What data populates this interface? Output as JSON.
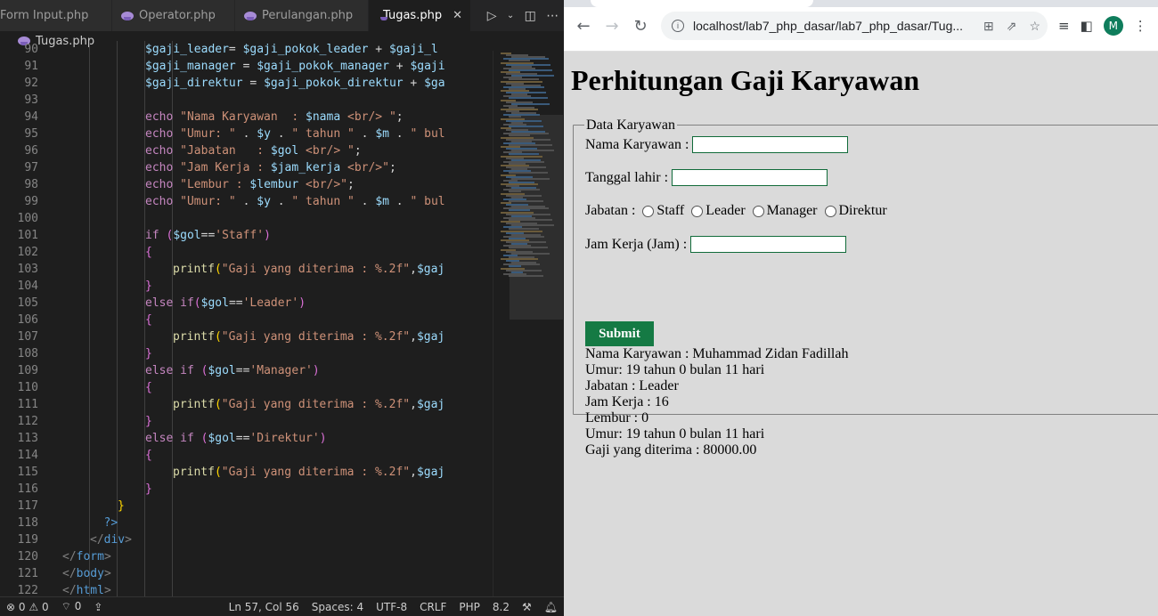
{
  "vscode": {
    "tabs": [
      {
        "label": "Form Input.php",
        "active": false
      },
      {
        "label": "Operator.php",
        "active": false
      },
      {
        "label": "Perulangan.php",
        "active": false
      },
      {
        "label": "Tugas.php",
        "active": true
      }
    ],
    "breadcrumb": "Tugas.php",
    "lines": [
      {
        "n": "90",
        "indent": 3,
        "tokens": [
          [
            "var",
            "$gaji_leader"
          ],
          [
            "",
            "= "
          ],
          [
            "var",
            "$gaji_pokok_leader"
          ],
          [
            "",
            " + "
          ],
          [
            "var",
            "$gaji_l"
          ]
        ]
      },
      {
        "n": "91",
        "indent": 3,
        "tokens": [
          [
            "var",
            "$gaji_manager"
          ],
          [
            "",
            " = "
          ],
          [
            "var",
            "$gaji_pokok_manager"
          ],
          [
            "",
            " + "
          ],
          [
            "var",
            "$gaji"
          ]
        ]
      },
      {
        "n": "92",
        "indent": 3,
        "tokens": [
          [
            "var",
            "$gaji_direktur"
          ],
          [
            "",
            " = "
          ],
          [
            "var",
            "$gaji_pokok_direktur"
          ],
          [
            "",
            " + "
          ],
          [
            "var",
            "$ga"
          ]
        ]
      },
      {
        "n": "93",
        "indent": 3,
        "tokens": []
      },
      {
        "n": "94",
        "indent": 3,
        "tokens": [
          [
            "kw",
            "echo "
          ],
          [
            "str",
            "\"Nama Karyawan  : "
          ],
          [
            "var",
            "$nama"
          ],
          [
            "str",
            " <br/> \""
          ],
          [
            "",
            ";"
          ]
        ]
      },
      {
        "n": "95",
        "indent": 3,
        "tokens": [
          [
            "kw",
            "echo "
          ],
          [
            "str",
            "\"Umur: \""
          ],
          [
            "",
            " . "
          ],
          [
            "var",
            "$y"
          ],
          [
            "",
            " . "
          ],
          [
            "str",
            "\" tahun \""
          ],
          [
            "",
            " . "
          ],
          [
            "var",
            "$m"
          ],
          [
            "",
            " . "
          ],
          [
            "str",
            "\" bul"
          ]
        ]
      },
      {
        "n": "96",
        "indent": 3,
        "tokens": [
          [
            "kw",
            "echo "
          ],
          [
            "str",
            "\"Jabatan   : "
          ],
          [
            "var",
            "$gol"
          ],
          [
            "str",
            " <br/> \""
          ],
          [
            "",
            ";"
          ]
        ]
      },
      {
        "n": "97",
        "indent": 3,
        "tokens": [
          [
            "kw",
            "echo "
          ],
          [
            "str",
            "\"Jam Kerja : "
          ],
          [
            "var",
            "$jam_kerja"
          ],
          [
            "str",
            " <br/>\""
          ],
          [
            "",
            ";"
          ]
        ]
      },
      {
        "n": "98",
        "indent": 3,
        "tokens": [
          [
            "kw",
            "echo "
          ],
          [
            "str",
            "\"Lembur : "
          ],
          [
            "var",
            "$lembur"
          ],
          [
            "str",
            " <br/>\""
          ],
          [
            "",
            ";"
          ]
        ]
      },
      {
        "n": "99",
        "indent": 3,
        "tokens": [
          [
            "kw",
            "echo "
          ],
          [
            "str",
            "\"Umur: \""
          ],
          [
            "",
            " . "
          ],
          [
            "var",
            "$y"
          ],
          [
            "",
            " . "
          ],
          [
            "str",
            "\" tahun \""
          ],
          [
            "",
            " . "
          ],
          [
            "var",
            "$m"
          ],
          [
            "",
            " . "
          ],
          [
            "str",
            "\" bul"
          ]
        ]
      },
      {
        "n": "100",
        "indent": 3,
        "tokens": []
      },
      {
        "n": "101",
        "indent": 3,
        "tokens": [
          [
            "kw",
            "if "
          ],
          [
            "brace2",
            "("
          ],
          [
            "var",
            "$gol"
          ],
          [
            "",
            "=="
          ],
          [
            "str",
            "'Staff'"
          ],
          [
            "brace2",
            ")"
          ]
        ]
      },
      {
        "n": "102",
        "indent": 3,
        "tokens": [
          [
            "brace2",
            "{"
          ]
        ]
      },
      {
        "n": "103",
        "indent": 4,
        "tokens": [
          [
            "fn",
            "printf"
          ],
          [
            "brace",
            "("
          ],
          [
            "str",
            "\"Gaji yang diterima : %.2f\""
          ],
          [
            "",
            ","
          ],
          [
            "var",
            "$gaj"
          ]
        ]
      },
      {
        "n": "104",
        "indent": 3,
        "tokens": [
          [
            "brace2",
            "}"
          ]
        ]
      },
      {
        "n": "105",
        "indent": 3,
        "tokens": [
          [
            "kw",
            "else if"
          ],
          [
            "brace2",
            "("
          ],
          [
            "var",
            "$gol"
          ],
          [
            "",
            "=="
          ],
          [
            "str",
            "'Leader'"
          ],
          [
            "brace2",
            ")"
          ]
        ]
      },
      {
        "n": "106",
        "indent": 3,
        "tokens": [
          [
            "brace2",
            "{"
          ]
        ]
      },
      {
        "n": "107",
        "indent": 4,
        "tokens": [
          [
            "fn",
            "printf"
          ],
          [
            "brace",
            "("
          ],
          [
            "str",
            "\"Gaji yang diterima : %.2f\""
          ],
          [
            "",
            ","
          ],
          [
            "var",
            "$gaj"
          ]
        ]
      },
      {
        "n": "108",
        "indent": 3,
        "tokens": [
          [
            "brace2",
            "}"
          ]
        ]
      },
      {
        "n": "109",
        "indent": 3,
        "tokens": [
          [
            "kw",
            "else if "
          ],
          [
            "brace2",
            "("
          ],
          [
            "var",
            "$gol"
          ],
          [
            "",
            "=="
          ],
          [
            "str",
            "'Manager'"
          ],
          [
            "brace2",
            ")"
          ]
        ]
      },
      {
        "n": "110",
        "indent": 3,
        "tokens": [
          [
            "brace2",
            "{"
          ]
        ]
      },
      {
        "n": "111",
        "indent": 4,
        "tokens": [
          [
            "fn",
            "printf"
          ],
          [
            "brace",
            "("
          ],
          [
            "str",
            "\"Gaji yang diterima : %.2f\""
          ],
          [
            "",
            ","
          ],
          [
            "var",
            "$gaj"
          ]
        ]
      },
      {
        "n": "112",
        "indent": 3,
        "tokens": [
          [
            "brace2",
            "}"
          ]
        ]
      },
      {
        "n": "113",
        "indent": 3,
        "tokens": [
          [
            "kw",
            "else if "
          ],
          [
            "brace2",
            "("
          ],
          [
            "var",
            "$gol"
          ],
          [
            "",
            "=="
          ],
          [
            "str",
            "'Direktur'"
          ],
          [
            "brace2",
            ")"
          ]
        ]
      },
      {
        "n": "114",
        "indent": 3,
        "tokens": [
          [
            "brace2",
            "{"
          ]
        ]
      },
      {
        "n": "115",
        "indent": 4,
        "tokens": [
          [
            "fn",
            "printf"
          ],
          [
            "brace",
            "("
          ],
          [
            "str",
            "\"Gaji yang diterima : %.2f\""
          ],
          [
            "",
            ","
          ],
          [
            "var",
            "$gaj"
          ]
        ]
      },
      {
        "n": "116",
        "indent": 3,
        "tokens": [
          [
            "brace2",
            "}"
          ]
        ]
      },
      {
        "n": "117",
        "indent": 2,
        "tokens": [
          [
            "brace",
            "}"
          ]
        ]
      },
      {
        "n": "118",
        "indent": 1.5,
        "tokens": [
          [
            "tag",
            "?>"
          ]
        ]
      },
      {
        "n": "119",
        "indent": 1,
        "tokens": [
          [
            "punc",
            "</"
          ],
          [
            "tag",
            "div"
          ],
          [
            "punc",
            ">"
          ]
        ]
      },
      {
        "n": "120",
        "indent": 0,
        "tokens": [
          [
            "punc",
            "</"
          ],
          [
            "tag",
            "form"
          ],
          [
            "punc",
            ">"
          ]
        ]
      },
      {
        "n": "121",
        "indent": 0,
        "tokens": [
          [
            "punc",
            "</"
          ],
          [
            "tag",
            "body"
          ],
          [
            "punc",
            ">"
          ]
        ]
      },
      {
        "n": "122",
        "indent": 0,
        "tokens": [
          [
            "punc",
            "</"
          ],
          [
            "tag",
            "html"
          ],
          [
            "punc",
            ">"
          ]
        ]
      }
    ],
    "status": {
      "errors": "0",
      "warnings": "0",
      "ports": "0",
      "position": "Ln 57, Col 56",
      "spaces": "Spaces: 4",
      "encoding": "UTF-8",
      "eol": "CRLF",
      "language": "PHP",
      "version": "8.2"
    }
  },
  "browser": {
    "url": "localhost/lab7_php_dasar/lab7_php_dasar/Tug...",
    "avatar_letter": "M",
    "page": {
      "heading": "Perhitungan Gaji Karyawan",
      "legend": "Data Karyawan",
      "name_label": "Nama Karyawan :",
      "dob_label": "Tanggal lahir :",
      "position_label": "Jabatan :",
      "radio_options": [
        "Staff",
        "Leader",
        "Manager",
        "Direktur"
      ],
      "hours_label": "Jam Kerja (Jam) :",
      "submit_label": "Submit",
      "output": [
        "Nama Karyawan : Muhammad Zidan Fadillah",
        "Umur: 19 tahun 0 bulan 11 hari",
        "Jabatan : Leader",
        "Jam Kerja : 16",
        "Lembur : 0",
        "Umur: 19 tahun 0 bulan 11 hari",
        "Gaji yang diterima : 80000.00"
      ]
    }
  },
  "colors": {
    "editor_bg": "#1e1e1e",
    "page_bg": "#dadada",
    "submit_bg": "#157a44",
    "input_border": "#116b3a"
  }
}
